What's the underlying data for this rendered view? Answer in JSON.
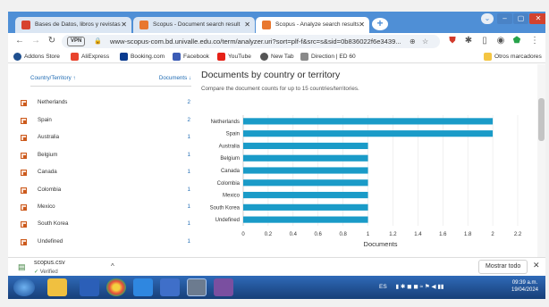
{
  "browser": {
    "tabs": [
      {
        "title": "Bases de Datos, libros y revistas"
      },
      {
        "title": "Scopus - Document search result"
      },
      {
        "title": "Scopus - Analyze search results"
      }
    ],
    "url": "www-scopus-com.bd.univalle.edu.co/term/analyzer.uri?sort=plf-f&src=s&sid=0b836022f6e3439...",
    "vpn_label": "VPN",
    "bookmarks": [
      "Addons Store",
      "AliExpress",
      "Booking.com",
      "Facebook",
      "YouTube",
      "New Tab",
      "Direction | ED 60"
    ],
    "other_bookmarks": "Otros marcadores"
  },
  "sidebar": {
    "col_country": "Country/Territory ↑",
    "col_documents": "Documents ↓",
    "rows": [
      {
        "name": "Netherlands",
        "count": "2"
      },
      {
        "name": "Spain",
        "count": "2"
      },
      {
        "name": "Australia",
        "count": "1"
      },
      {
        "name": "Belgium",
        "count": "1"
      },
      {
        "name": "Canada",
        "count": "1"
      },
      {
        "name": "Colombia",
        "count": "1"
      },
      {
        "name": "Mexico",
        "count": "1"
      },
      {
        "name": "South Korea",
        "count": "1"
      },
      {
        "name": "Undefined",
        "count": "1"
      }
    ]
  },
  "chart_header": {
    "title": "Documents by country or territory",
    "subtitle": "Compare the document counts for up to 15 countries/territories."
  },
  "chart_data": {
    "type": "bar",
    "orientation": "horizontal",
    "categories": [
      "Netherlands",
      "Spain",
      "Australia",
      "Belgium",
      "Canada",
      "Colombia",
      "Mexico",
      "South Korea",
      "Undefined"
    ],
    "values": [
      2,
      2,
      1,
      1,
      1,
      1,
      1,
      1,
      1
    ],
    "xlabel": "Documents",
    "xlim": [
      0,
      2.2
    ],
    "xticks": [
      "0",
      "0.2",
      "0.4",
      "0.6",
      "0.8",
      "1",
      "1.2",
      "1.4",
      "1.6",
      "1.8",
      "2",
      "2.2"
    ],
    "bar_color": "#1a9bc8",
    "grid": true
  },
  "download": {
    "filename": "scopus.csv",
    "status": "Verified",
    "show_all": "Mostrar todo"
  },
  "taskbar": {
    "lang": "ES",
    "time": "09:39 a.m.",
    "date": "19/04/2024"
  }
}
